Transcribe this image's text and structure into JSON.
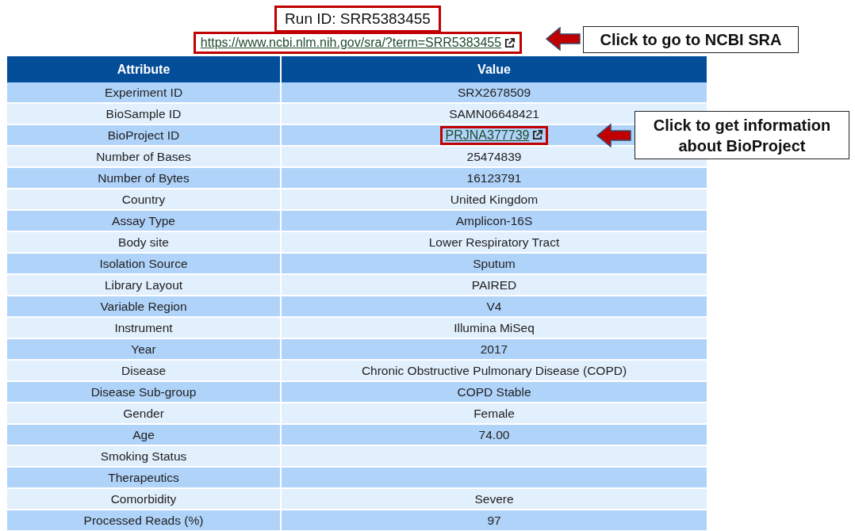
{
  "run_id": "Run ID: SRR5383455",
  "run_link": "https://www.ncbi.nlm.nih.gov/sra/?term=SRR5383455",
  "table": {
    "columns": [
      "Attribute",
      "Value"
    ],
    "rows": [
      {
        "attribute": "Experiment ID",
        "value": "SRX2678509",
        "kind": "text"
      },
      {
        "attribute": "BioSample ID",
        "value": "SAMN06648421",
        "kind": "text"
      },
      {
        "attribute": "BioProject ID",
        "value": "PRJNA377739",
        "kind": "link"
      },
      {
        "attribute": "Number of Bases",
        "value": "25474839",
        "kind": "text"
      },
      {
        "attribute": "Number of Bytes",
        "value": "16123791",
        "kind": "text"
      },
      {
        "attribute": "Country",
        "value": "United Kingdom",
        "kind": "text"
      },
      {
        "attribute": "Assay Type",
        "value": "Amplicon-16S",
        "kind": "text"
      },
      {
        "attribute": "Body site",
        "value": "Lower Respiratory Tract",
        "kind": "text"
      },
      {
        "attribute": "Isolation Source",
        "value": "Sputum",
        "kind": "text"
      },
      {
        "attribute": "Library Layout",
        "value": "PAIRED",
        "kind": "text"
      },
      {
        "attribute": "Variable Region",
        "value": "V4",
        "kind": "text"
      },
      {
        "attribute": "Instrument",
        "value": "Illumina MiSeq",
        "kind": "text"
      },
      {
        "attribute": "Year",
        "value": "2017",
        "kind": "text"
      },
      {
        "attribute": "Disease",
        "value": "Chronic Obstructive Pulmonary Disease (COPD)",
        "kind": "text"
      },
      {
        "attribute": "Disease Sub-group",
        "value": "COPD Stable",
        "kind": "text"
      },
      {
        "attribute": "Gender",
        "value": "Female",
        "kind": "text"
      },
      {
        "attribute": "Age",
        "value": "74.00",
        "kind": "text"
      },
      {
        "attribute": "Smoking Status",
        "kind": "text"
      },
      {
        "attribute": "Therapeutics",
        "kind": "text"
      },
      {
        "attribute": "Comorbidity",
        "value": "Severe",
        "kind": "text"
      },
      {
        "attribute": "Processed Reads (%)",
        "value": "97",
        "kind": "text"
      }
    ]
  },
  "callouts": [
    "Click to go to NCBI SRA",
    "Click to get information about BioProject"
  ]
}
